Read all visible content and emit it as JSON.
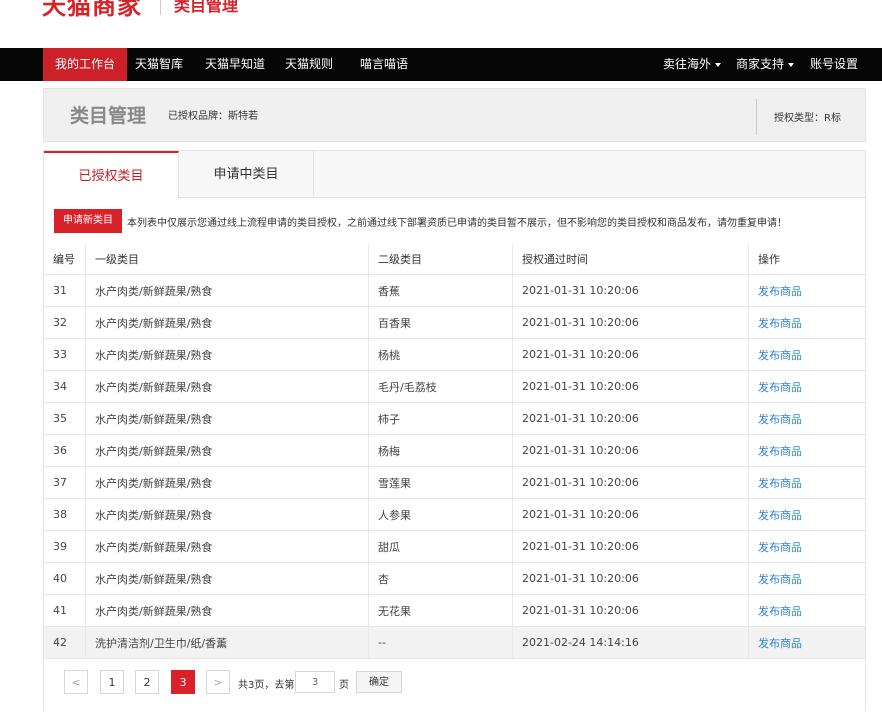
{
  "header": {
    "logo": "天猫商家",
    "subtitle": "类目管理"
  },
  "nav": {
    "left": [
      "我的工作台",
      "天猫智库",
      "天猫早知道",
      "天猫规则",
      "喵言喵语"
    ],
    "right": [
      "卖往海外",
      "商家支持",
      "账号设置"
    ]
  },
  "page": {
    "title": "类目管理",
    "brand_info": "已授权品牌：斯特若",
    "auth_type": "授权类型：R标"
  },
  "tabs": [
    "已授权类目",
    "申请中类目"
  ],
  "notice": {
    "button": "申请新类目",
    "text": "本列表中仅展示您通过线上流程申请的类目授权，之前通过线下部署资质已申请的类目暂不展示，但不影响您的类目授权和商品发布，请勿重复申请！"
  },
  "table": {
    "headers": [
      "编号",
      "一级类目",
      "二级类目",
      "授权通过时间",
      "操作"
    ],
    "rows": [
      {
        "no": "31",
        "cat1": "水产肉类/新鲜蔬果/熟食",
        "cat2": "香蕉",
        "time": "2021-01-31 10:20:06",
        "action": "发布商品"
      },
      {
        "no": "32",
        "cat1": "水产肉类/新鲜蔬果/熟食",
        "cat2": "百香果",
        "time": "2021-01-31 10:20:06",
        "action": "发布商品"
      },
      {
        "no": "33",
        "cat1": "水产肉类/新鲜蔬果/熟食",
        "cat2": "杨桃",
        "time": "2021-01-31 10:20:06",
        "action": "发布商品"
      },
      {
        "no": "34",
        "cat1": "水产肉类/新鲜蔬果/熟食",
        "cat2": "毛丹/毛荔枝",
        "time": "2021-01-31 10:20:06",
        "action": "发布商品"
      },
      {
        "no": "35",
        "cat1": "水产肉类/新鲜蔬果/熟食",
        "cat2": "柿子",
        "time": "2021-01-31 10:20:06",
        "action": "发布商品"
      },
      {
        "no": "36",
        "cat1": "水产肉类/新鲜蔬果/熟食",
        "cat2": "杨梅",
        "time": "2021-01-31 10:20:06",
        "action": "发布商品"
      },
      {
        "no": "37",
        "cat1": "水产肉类/新鲜蔬果/熟食",
        "cat2": "雪莲果",
        "time": "2021-01-31 10:20:06",
        "action": "发布商品"
      },
      {
        "no": "38",
        "cat1": "水产肉类/新鲜蔬果/熟食",
        "cat2": "人参果",
        "time": "2021-01-31 10:20:06",
        "action": "发布商品"
      },
      {
        "no": "39",
        "cat1": "水产肉类/新鲜蔬果/熟食",
        "cat2": "甜瓜",
        "time": "2021-01-31 10:20:06",
        "action": "发布商品"
      },
      {
        "no": "40",
        "cat1": "水产肉类/新鲜蔬果/熟食",
        "cat2": "杏",
        "time": "2021-01-31 10:20:06",
        "action": "发布商品"
      },
      {
        "no": "41",
        "cat1": "水产肉类/新鲜蔬果/熟食",
        "cat2": "无花果",
        "time": "2021-01-31 10:20:06",
        "action": "发布商品"
      },
      {
        "no": "42",
        "cat1": "洗护清洁剂/卫生巾/纸/香薰",
        "cat2": "--",
        "time": "2021-02-24 14:14:16",
        "action": "发布商品"
      }
    ]
  },
  "pagination": {
    "prev": "<",
    "pages": [
      "1",
      "2",
      "3"
    ],
    "current": "3",
    "next": ">",
    "total_text": "共3页，去第",
    "input_value": "3",
    "page_unit": "页",
    "confirm": "确定"
  },
  "colors": {
    "brand_red": "#d92128",
    "nav_bg": "#060606",
    "link_blue": "#2e84d0"
  }
}
